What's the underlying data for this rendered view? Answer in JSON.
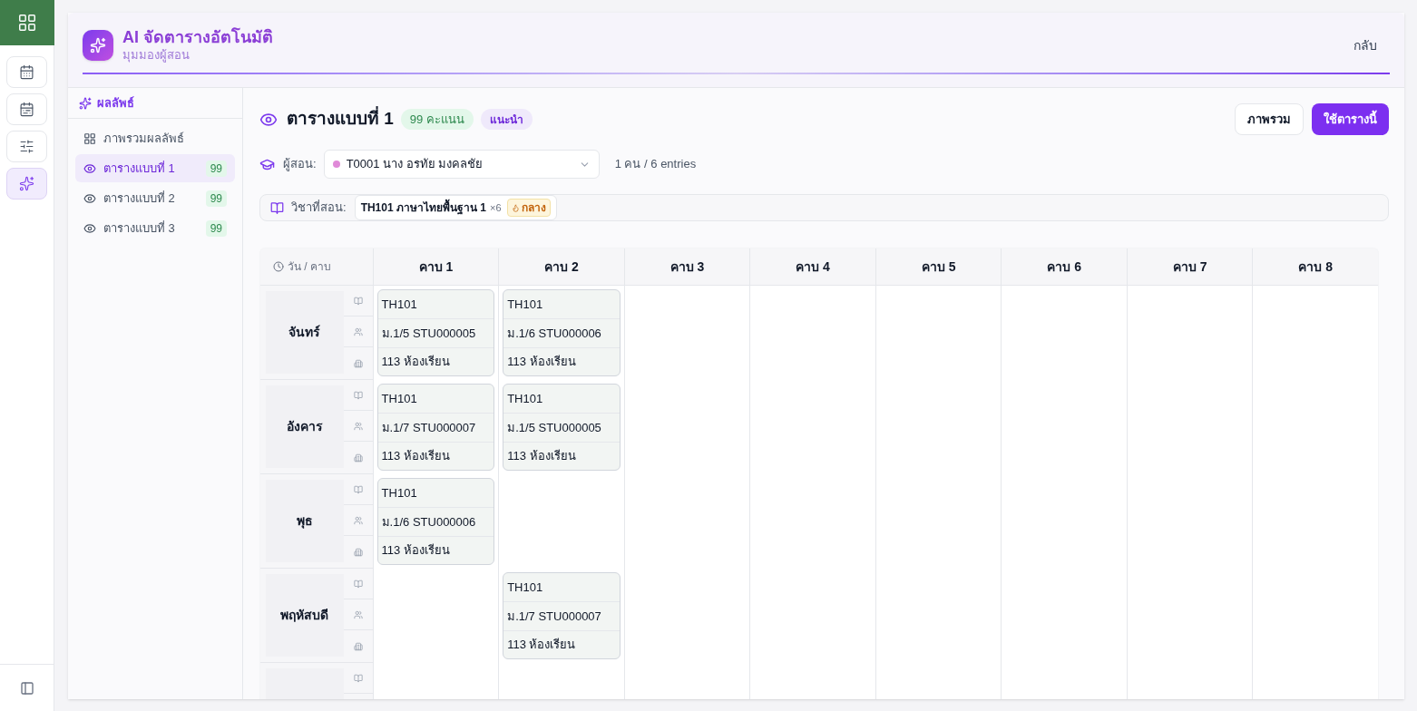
{
  "rail": [
    {
      "selected": false,
      "kind": "brand"
    },
    {
      "selected": false,
      "kind": "item"
    },
    {
      "selected": false,
      "kind": "item"
    },
    {
      "selected": false,
      "kind": "item"
    },
    {
      "selected": true,
      "kind": "item"
    }
  ],
  "header": {
    "title": "AI จัดตารางอัตโนมัติ",
    "subtitle": "มุมมองผู้สอน",
    "back": "กลับ"
  },
  "sidebar": {
    "heading": "ผลลัพธ์",
    "items": [
      {
        "label": "ภาพรวมผลลัพธ์",
        "kind": "overview",
        "selected": false
      },
      {
        "label": "ตารางแบบที่ 1",
        "kind": "option",
        "badge": "99",
        "selected": true
      },
      {
        "label": "ตารางแบบที่ 2",
        "kind": "option",
        "badge": "99",
        "selected": false
      },
      {
        "label": "ตารางแบบที่ 3",
        "kind": "option",
        "badge": "99",
        "selected": false
      }
    ]
  },
  "content": {
    "title": "ตารางแบบที่ 1",
    "score": "99",
    "score_unit": "คะแนน",
    "tag": "แนะนำ",
    "buttons": [
      {
        "label": "ภาพรวม",
        "kind": "secondary"
      },
      {
        "label": "ใช้ตารางนี้",
        "kind": "primary"
      }
    ],
    "teacher_label": "ผู้สอน:",
    "teacher": {
      "value": "T0001 นาง อรทัย มงคลชัย",
      "color": "#e08ad8"
    },
    "count": "1 คน / 6 entries",
    "subjects_label": "วิชาที่สอน:",
    "subjects": [
      {
        "name": "TH101 ภาษาไทยพื้นฐาน 1",
        "times": "×6",
        "level": "กลาง"
      }
    ]
  },
  "table": {
    "corner": "วัน / คาบ",
    "columns": [
      "คาบ 1",
      "คาบ 2",
      "คาบ 3",
      "คาบ 4",
      "คาบ 5",
      "คาบ 6",
      "คาบ 7",
      "คาบ 8"
    ],
    "rows": [
      {
        "day": "จันทร์",
        "slots": [
          {
            "kind": "lesson",
            "subject": "TH101",
            "group": "ม.1/5 STU000005",
            "room": "113 ห้องเรียน"
          },
          {
            "kind": "lesson",
            "subject": "TH101",
            "group": "ม.1/6 STU000006",
            "room": "113 ห้องเรียน"
          },
          {
            "kind": "empty"
          },
          {
            "kind": "empty"
          },
          {
            "kind": "empty"
          },
          {
            "kind": "empty"
          },
          {
            "kind": "empty"
          },
          {
            "kind": "empty"
          }
        ]
      },
      {
        "day": "อังคาร",
        "slots": [
          {
            "kind": "lesson",
            "subject": "TH101",
            "group": "ม.1/7 STU000007",
            "room": "113 ห้องเรียน"
          },
          {
            "kind": "lesson",
            "subject": "TH101",
            "group": "ม.1/5 STU000005",
            "room": "113 ห้องเรียน"
          },
          {
            "kind": "empty"
          },
          {
            "kind": "empty"
          },
          {
            "kind": "empty"
          },
          {
            "kind": "empty"
          },
          {
            "kind": "empty"
          },
          {
            "kind": "empty"
          }
        ]
      },
      {
        "day": "พุธ",
        "slots": [
          {
            "kind": "lesson",
            "subject": "TH101",
            "group": "ม.1/6 STU000006",
            "room": "113 ห้องเรียน"
          },
          {
            "kind": "empty"
          },
          {
            "kind": "empty"
          },
          {
            "kind": "empty"
          },
          {
            "kind": "empty"
          },
          {
            "kind": "empty"
          },
          {
            "kind": "empty"
          },
          {
            "kind": "empty"
          }
        ]
      },
      {
        "day": "พฤหัสบดี",
        "slots": [
          {
            "kind": "empty"
          },
          {
            "kind": "lesson",
            "subject": "TH101",
            "group": "ม.1/7 STU000007",
            "room": "113 ห้องเรียน"
          },
          {
            "kind": "empty"
          },
          {
            "kind": "empty"
          },
          {
            "kind": "empty"
          },
          {
            "kind": "empty"
          },
          {
            "kind": "empty"
          },
          {
            "kind": "empty"
          }
        ]
      },
      {
        "slots": [
          {
            "kind": "empty"
          },
          {
            "kind": "empty"
          },
          {
            "kind": "empty"
          },
          {
            "kind": "empty"
          },
          {
            "kind": "empty"
          },
          {
            "kind": "empty"
          },
          {
            "kind": "empty"
          },
          {
            "kind": "empty"
          }
        ]
      }
    ]
  }
}
